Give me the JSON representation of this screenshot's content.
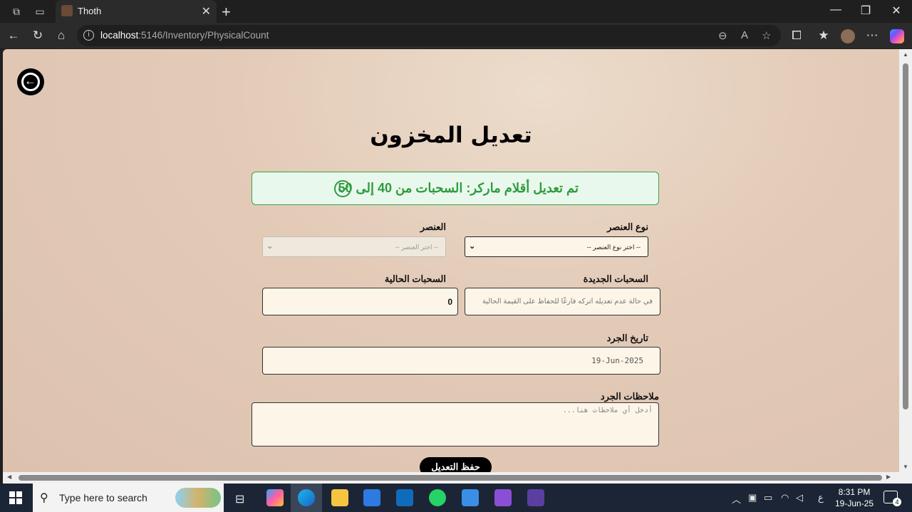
{
  "browser": {
    "tab_title": "Thoth",
    "url_host": "localhost",
    "url_path": ":5146/Inventory/PhysicalCount",
    "accent": "#2b2b2b"
  },
  "page": {
    "title": "تعديل المخزون",
    "alert_text": "تم تعديل أقلام ماركر: السحبات من 40 إلى 50",
    "alert_color": "#2f9b3f",
    "fields": {
      "item_type_label": "نوع العنصر",
      "item_type_value": "-- اختر نوع العنصر --",
      "item_label": "العنصر",
      "item_value": "-- اختر العنصر --",
      "new_pulls_label": "السحبات الجديدة",
      "new_pulls_placeholder": "في حالة عدم تعديله اتركه فارغًا للحفاظ على القيمة الحالية",
      "current_pulls_label": "السحبات الحالية",
      "current_pulls_value": "0",
      "count_date_label": "تاريخ الجرد",
      "count_date_value": "19-Jun-2025",
      "notes_label": "ملاحظات الجرد",
      "notes_placeholder": "أدخل أي ملاحظات هنا..."
    },
    "save_label": "حفظ التعديل"
  },
  "taskbar": {
    "search_placeholder": "Type here to search",
    "time": "8:31 PM",
    "date": "19-Jun-25",
    "lang": "ع",
    "notifications": "4"
  }
}
